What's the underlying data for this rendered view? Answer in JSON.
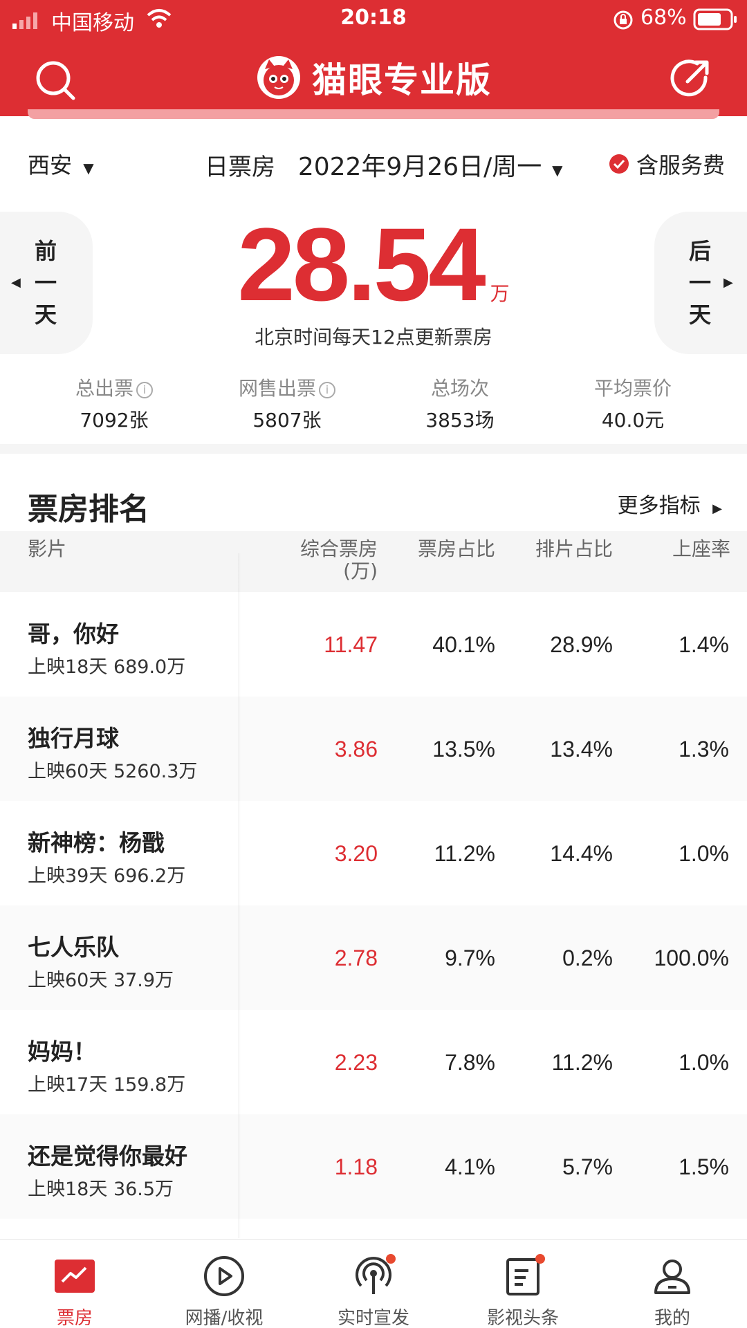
{
  "status_bar": {
    "carrier": "中国移动",
    "time": "20:18",
    "battery": "68%"
  },
  "header": {
    "title": "猫眼专业版"
  },
  "date_row": {
    "city": "西安",
    "type": "日票房",
    "date": "2022年9月26日/周一",
    "service_fee": "含服务费"
  },
  "summary": {
    "prev_day": [
      "前",
      "一",
      "天"
    ],
    "next_day": [
      "后",
      "一",
      "天"
    ],
    "box_office": "28.54",
    "unit": "万",
    "note": "北京时间每天12点更新票房"
  },
  "stats": [
    {
      "label": "总出票",
      "value": "7092张",
      "info": true
    },
    {
      "label": "网售出票",
      "value": "5807张",
      "info": true
    },
    {
      "label": "总场次",
      "value": "3853场",
      "info": false
    },
    {
      "label": "平均票价",
      "value": "40.0元",
      "info": false
    }
  ],
  "ranking": {
    "title": "票房排名",
    "more": "更多指标",
    "columns": {
      "film": "影片",
      "box_office": "综合票房",
      "box_office_unit": "(万)",
      "bo_share": "票房占比",
      "show_share": "排片占比",
      "occupancy": "上座率"
    },
    "rows": [
      {
        "name": "哥，你好",
        "sub": "上映18天 689.0万",
        "box": "11.47",
        "bo_share": "40.1%",
        "show_share": "28.9%",
        "occ": "1.4%"
      },
      {
        "name": "独行月球",
        "sub": "上映60天 5260.3万",
        "box": "3.86",
        "bo_share": "13.5%",
        "show_share": "13.4%",
        "occ": "1.3%"
      },
      {
        "name": "新神榜：杨戬",
        "sub": "上映39天 696.2万",
        "box": "3.20",
        "bo_share": "11.2%",
        "show_share": "14.4%",
        "occ": "1.0%"
      },
      {
        "name": "七人乐队",
        "sub": "上映60天 37.9万",
        "box": "2.78",
        "bo_share": "9.7%",
        "show_share": "0.2%",
        "occ": "100.0%"
      },
      {
        "name": "妈妈！",
        "sub": "上映17天 159.8万",
        "box": "2.23",
        "bo_share": "7.8%",
        "show_share": "11.2%",
        "occ": "1.0%"
      },
      {
        "name": "还是觉得你最好",
        "sub": "上映18天 36.5万",
        "box": "1.18",
        "bo_share": "4.1%",
        "show_share": "5.7%",
        "occ": "1.5%"
      }
    ]
  },
  "tabs": [
    {
      "label": "票房",
      "icon": "chart-icon",
      "active": true
    },
    {
      "label": "网播/收视",
      "icon": "play-icon",
      "active": false
    },
    {
      "label": "实时宣发",
      "icon": "broadcast-icon",
      "active": false
    },
    {
      "label": "影视头条",
      "icon": "news-icon",
      "active": false
    },
    {
      "label": "我的",
      "icon": "profile-icon",
      "active": false
    }
  ],
  "colors": {
    "brand": "#dd2e33",
    "badge": "#e8492f"
  }
}
